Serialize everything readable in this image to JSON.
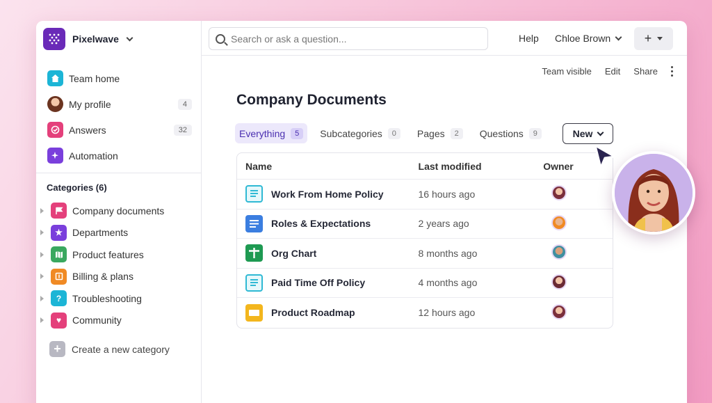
{
  "workspace": {
    "name": "Pixelwave"
  },
  "sidebar": {
    "nav": [
      {
        "label": "Team home",
        "icon": "home-icon",
        "color": "#1cb5d6"
      },
      {
        "label": "My profile",
        "icon": "avatar",
        "count": "4"
      },
      {
        "label": "Answers",
        "icon": "answers-icon",
        "count": "32",
        "color": "#e4407b"
      },
      {
        "label": "Automation",
        "icon": "sparkle-icon",
        "color": "#7a3fdc"
      }
    ],
    "categories_title": "Categories (6)",
    "categories": [
      {
        "label": "Company documents",
        "icon": "flag-icon",
        "color": "#e4407b"
      },
      {
        "label": "Departments",
        "icon": "star-icon",
        "color": "#7a3fdc"
      },
      {
        "label": "Product features",
        "icon": "map-icon",
        "color": "#3aa85f"
      },
      {
        "label": "Billing & plans",
        "icon": "money-icon",
        "color": "#f08a24"
      },
      {
        "label": "Troubleshooting",
        "icon": "question-icon",
        "color": "#1cb5d6"
      },
      {
        "label": "Community",
        "icon": "heart-icon",
        "color": "#e4407b"
      }
    ],
    "create_label": "Create a new category"
  },
  "topbar": {
    "search_placeholder": "Search or ask a question...",
    "help": "Help",
    "user": "Chloe Brown",
    "plus": "+"
  },
  "page": {
    "actions": {
      "visibility": "Team visible",
      "edit": "Edit",
      "share": "Share"
    },
    "title": "Company Documents",
    "tabs": [
      {
        "label": "Everything",
        "count": "5",
        "active": true
      },
      {
        "label": "Subcategories",
        "count": "0"
      },
      {
        "label": "Pages",
        "count": "2"
      },
      {
        "label": "Questions",
        "count": "9"
      }
    ],
    "new_button": "New",
    "table": {
      "headers": {
        "name": "Name",
        "modified": "Last modified",
        "owner": "Owner"
      },
      "rows": [
        {
          "name": "Work From Home Policy",
          "modified": "16 hours ago",
          "icon": "doc-icon",
          "color": "#2fb9d4"
        },
        {
          "name": "Roles & Expectations",
          "modified": "2 years ago",
          "icon": "doc-icon",
          "color": "#3b7ee0"
        },
        {
          "name": "Org Chart",
          "modified": "8 months ago",
          "icon": "sheet-icon",
          "color": "#1e9a52"
        },
        {
          "name": "Paid Time Off Policy",
          "modified": "4 months ago",
          "icon": "doc-icon",
          "color": "#2fb9d4"
        },
        {
          "name": "Product Roadmap",
          "modified": "12 hours ago",
          "icon": "slides-icon",
          "color": "#f3b61d"
        }
      ]
    }
  }
}
